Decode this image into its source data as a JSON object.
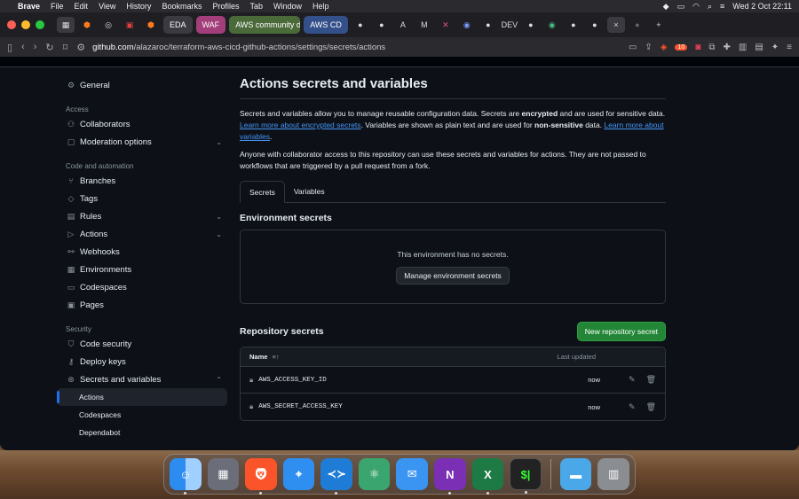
{
  "menubar": {
    "app_name": "Brave",
    "menus": [
      "File",
      "Edit",
      "View",
      "History",
      "Bookmarks",
      "Profiles",
      "Tab",
      "Window",
      "Help"
    ],
    "datetime": "Wed 2 Oct  22:11"
  },
  "browser": {
    "tabs": {
      "eda": "EDA",
      "waf": "WAF",
      "aws_community": "AWS community d",
      "aws_cd": "AWS CD",
      "dev": "DEV",
      "close": "×",
      "new": "+"
    },
    "url_host": "github.com",
    "url_path": "/alazaroc/terraform-aws-cicd-github-actions/settings/secrets/actions",
    "shield_count": "10"
  },
  "sidebar": {
    "general": "General",
    "access_heading": "Access",
    "collaborators": "Collaborators",
    "moderation": "Moderation options",
    "code_heading": "Code and automation",
    "branches": "Branches",
    "tags": "Tags",
    "rules": "Rules",
    "actions": "Actions",
    "webhooks": "Webhooks",
    "environments": "Environments",
    "codespaces": "Codespaces",
    "pages": "Pages",
    "security_heading": "Security",
    "code_security": "Code security",
    "deploy_keys": "Deploy keys",
    "secrets_vars": "Secrets and variables",
    "sub_actions": "Actions",
    "sub_codespaces": "Codespaces",
    "sub_dependabot": "Dependabot"
  },
  "main": {
    "title": "Actions secrets and variables",
    "p1_a": "Secrets and variables allow you to manage reusable configuration data. Secrets are ",
    "p1_b": "encrypted",
    "p1_c": " and are used for sensitive data. ",
    "p1_link1": "Learn more about encrypted secrets",
    "p1_d": ". Variables are shown as plain text and are used for ",
    "p1_e": "non-sensitive",
    "p1_f": " data. ",
    "p1_link2": "Learn more about variables",
    "p1_g": ".",
    "p2": "Anyone with collaborator access to this repository can use these secrets and variables for actions. They are not passed to workflows that are triggered by a pull request from a fork.",
    "tab_secrets": "Secrets",
    "tab_variables": "Variables",
    "env_heading": "Environment secrets",
    "env_empty": "This environment has no secrets.",
    "env_button": "Manage environment secrets",
    "repo_heading": "Repository secrets",
    "new_secret_button": "New repository secret",
    "col_name": "Name",
    "col_updated": "Last updated",
    "secrets": [
      {
        "name": "AWS_ACCESS_KEY_ID",
        "updated": "now"
      },
      {
        "name": "AWS_SECRET_ACCESS_KEY",
        "updated": "now"
      }
    ]
  },
  "dock": [
    "Finder",
    "Launchpad",
    "Brave",
    "Safari",
    "VS Code",
    "Atom",
    "Mail",
    "OneNote",
    "Excel",
    "Terminal",
    "Folder",
    "Trash"
  ]
}
